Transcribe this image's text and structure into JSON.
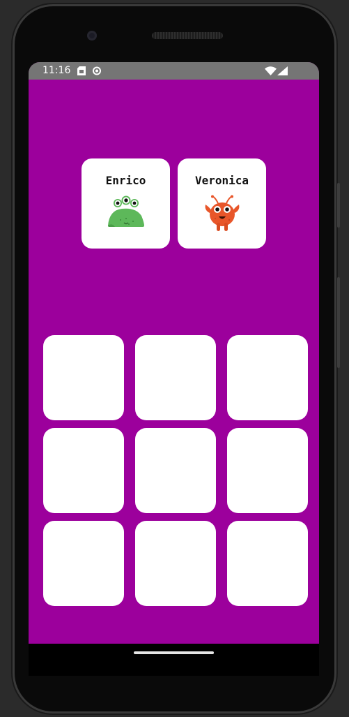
{
  "status_bar": {
    "time": "11:16",
    "icons": [
      "sim-card-icon",
      "sync-icon",
      "wifi-icon",
      "cell-signal-icon"
    ]
  },
  "players": [
    {
      "name": "Enrico",
      "avatar": "green-three-eyed-monster-icon",
      "color": "#5cb85c"
    },
    {
      "name": "Veronica",
      "avatar": "orange-antenna-monster-icon",
      "color": "#e8562a"
    }
  ],
  "board": {
    "rows": 3,
    "cols": 3,
    "cells": [
      "",
      "",
      "",
      "",
      "",
      "",
      "",
      "",
      ""
    ]
  },
  "colors": {
    "background": "#9c009c",
    "status_bar": "#757575",
    "card": "#ffffff"
  }
}
